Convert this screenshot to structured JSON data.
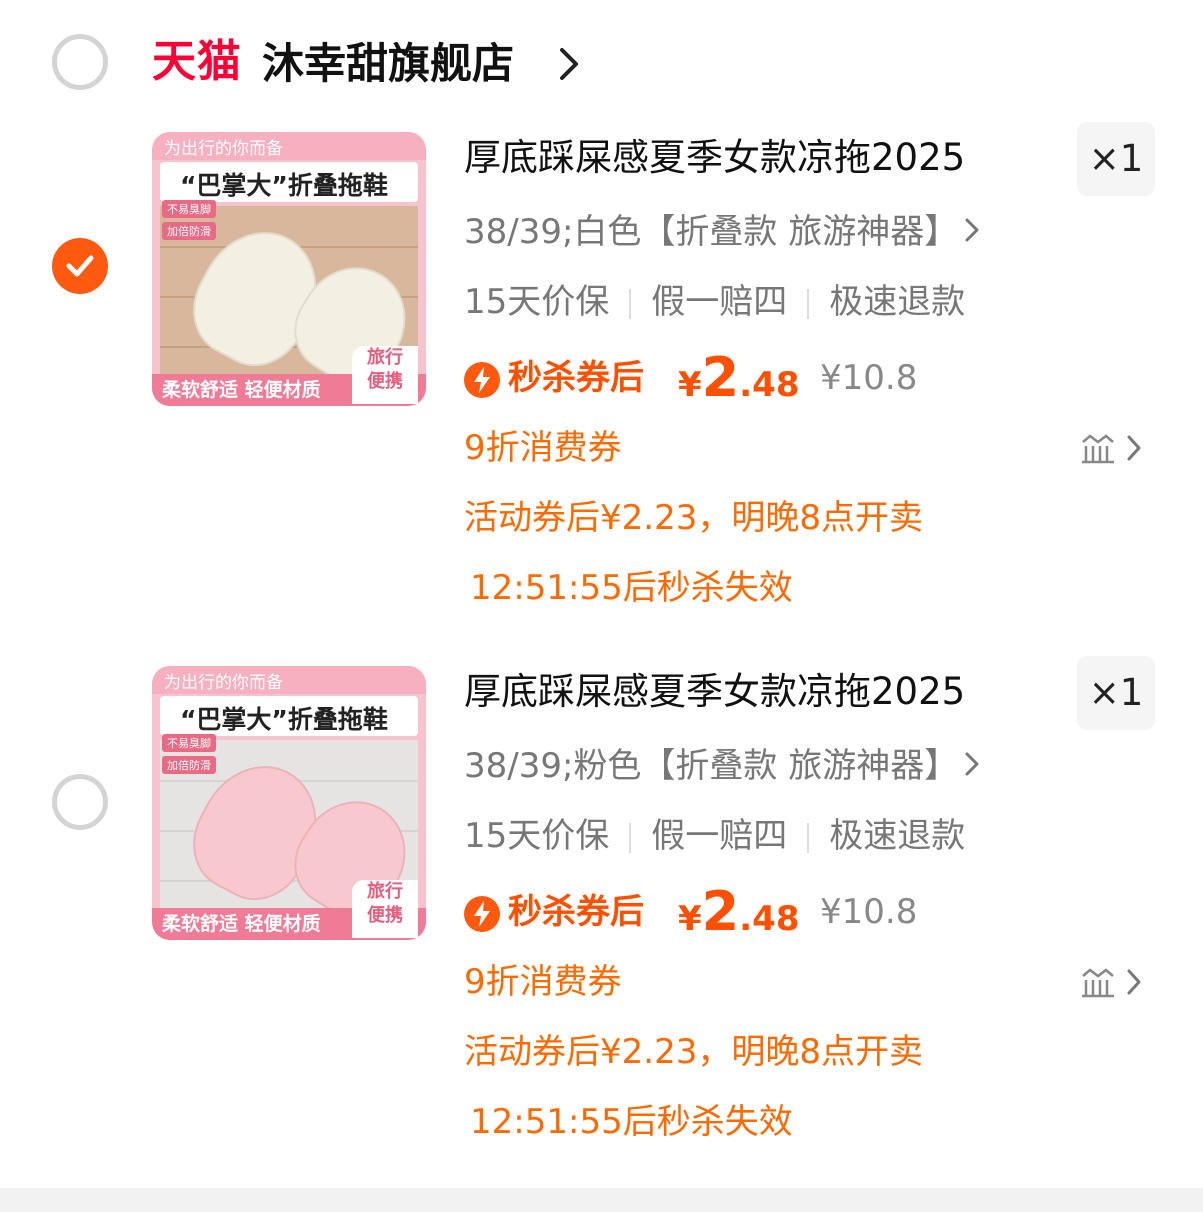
{
  "store": {
    "platform_logo": "天猫",
    "name": "沐幸甜旗舰店"
  },
  "items": [
    {
      "selected": false,
      "thumbnail": {
        "tagline": "为出行的你而备",
        "headline": "“巴掌大”折叠拖鞋",
        "chips": [
          "不易臭脚",
          "加倍防滑"
        ],
        "bottom_text": "柔软舒适 轻便材质",
        "travel_badge": [
          "旅行",
          "便携"
        ],
        "slipper_color": "#f3efe3"
      },
      "title": "厚底踩屎感夏季女款凉拖2025",
      "quantity": "×1",
      "sku": "38/39;白色【折叠款 旅游神器】",
      "services": [
        "15天价保",
        "假一赔四",
        "极速退款"
      ],
      "price": {
        "label": "秒杀券后",
        "currency": "¥",
        "integer": "2",
        "decimal": ".48",
        "original": "¥10.8"
      },
      "coupon": "9折消费券",
      "promo": "活动券后¥2.23，明晚8点开卖",
      "countdown": "12:51:55后秒杀失效"
    },
    {
      "selected": false,
      "thumbnail": {
        "tagline": "为出行的你而备",
        "headline": "“巴掌大”折叠拖鞋",
        "chips": [
          "不易臭脚",
          "加倍防滑"
        ],
        "bottom_text": "柔软舒适 轻便材质",
        "travel_badge": [
          "旅行",
          "便携"
        ],
        "slipper_color": "#f7c9cf"
      },
      "title": "厚底踩屎感夏季女款凉拖2025",
      "quantity": "×1",
      "sku": "38/39;粉色【折叠款 旅游神器】",
      "services": [
        "15天价保",
        "假一赔四",
        "极速退款"
      ],
      "price": {
        "label": "秒杀券后",
        "currency": "¥",
        "integer": "2",
        "decimal": ".48",
        "original": "¥10.8"
      },
      "coupon": "9折消费券",
      "promo": "活动券后¥2.23，明晚8点开卖",
      "countdown": "12:51:55后秒杀失效"
    }
  ],
  "first_item_checked": true,
  "colors": {
    "accent": "#ff5a0f",
    "price": "#ff5000",
    "promo": "#ff6a00",
    "tmall_red": "#ff0036"
  }
}
